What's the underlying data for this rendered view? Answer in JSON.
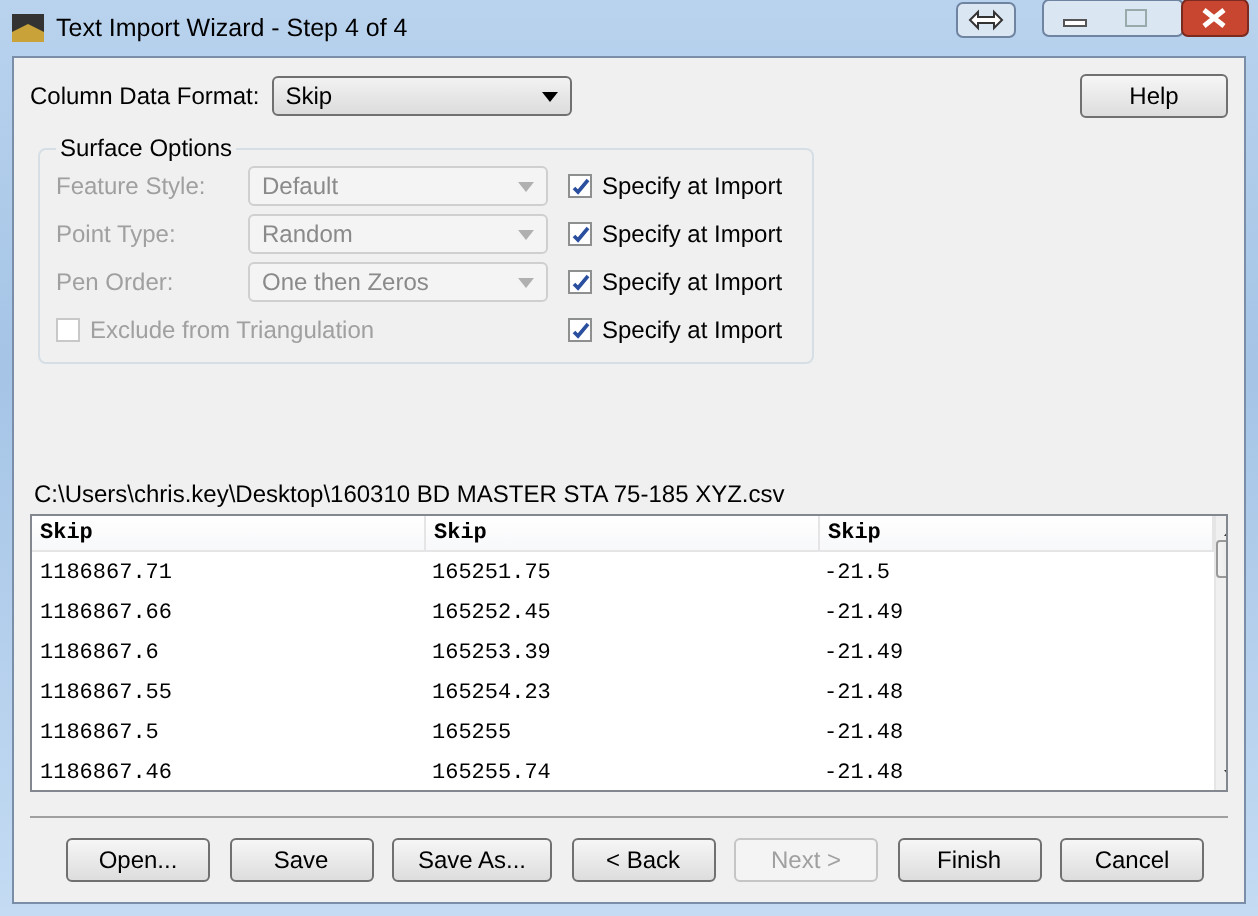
{
  "window": {
    "title": "Text Import Wizard - Step 4 of 4"
  },
  "format": {
    "label": "Column Data Format:",
    "value": "Skip"
  },
  "help_button": "Help",
  "surface_options": {
    "title": "Surface Options",
    "rows": [
      {
        "kind": "select",
        "label": "Feature Style:",
        "value": "Default",
        "disabled": true,
        "specify": {
          "label": "Specify at Import",
          "checked": true
        }
      },
      {
        "kind": "select",
        "label": "Point Type:",
        "value": "Random",
        "disabled": true,
        "specify": {
          "label": "Specify at Import",
          "checked": true
        }
      },
      {
        "kind": "select",
        "label": "Pen Order:",
        "value": "One then Zeros",
        "disabled": true,
        "specify": {
          "label": "Specify at Import",
          "checked": true
        }
      },
      {
        "kind": "checkbox",
        "label": "Exclude from Triangulation",
        "checked": false,
        "disabled": true,
        "specify": {
          "label": "Specify at Import",
          "checked": true
        }
      }
    ]
  },
  "file_path": "C:\\Users\\chris.key\\Desktop\\160310 BD MASTER STA 75-185 XYZ.csv",
  "table": {
    "columns": [
      "Skip",
      "Skip",
      "Skip"
    ],
    "rows": [
      [
        "1186867.71",
        "165251.75",
        "-21.5"
      ],
      [
        "1186867.66",
        "165252.45",
        "-21.49"
      ],
      [
        "1186867.6",
        "165253.39",
        "-21.49"
      ],
      [
        "1186867.55",
        "165254.23",
        "-21.48"
      ],
      [
        "1186867.5",
        "165255",
        "-21.48"
      ],
      [
        "1186867.46",
        "165255.74",
        "-21.48"
      ]
    ]
  },
  "buttons": [
    {
      "label": "Open...",
      "disabled": false
    },
    {
      "label": "Save",
      "disabled": false
    },
    {
      "label": "Save As...",
      "disabled": false
    },
    {
      "label": "< Back",
      "disabled": false
    },
    {
      "label": "Next >",
      "disabled": true
    },
    {
      "label": "Finish",
      "disabled": false
    },
    {
      "label": "Cancel",
      "disabled": false
    }
  ]
}
